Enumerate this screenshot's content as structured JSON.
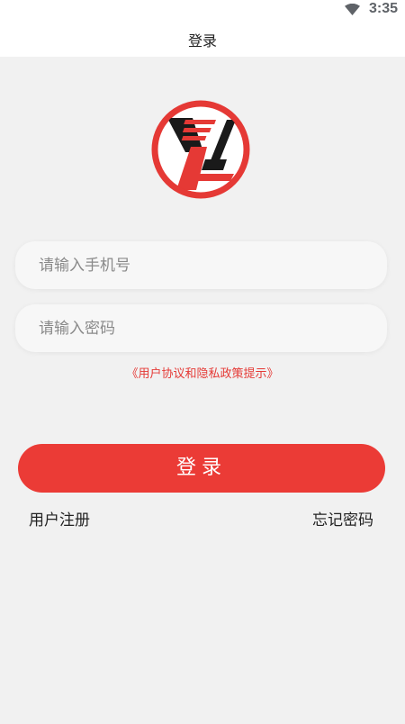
{
  "status_bar": {
    "time": "3:35"
  },
  "header": {
    "title": "登录"
  },
  "form": {
    "phone_placeholder": "请输入手机号",
    "password_placeholder": "请输入密码",
    "agreement_text": "《用户协议和隐私政策提示》",
    "login_label": "登录"
  },
  "footer": {
    "register_label": "用户注册",
    "forgot_label": "忘记密码"
  },
  "colors": {
    "accent": "#eb3b36",
    "background": "#f1f1f1"
  }
}
